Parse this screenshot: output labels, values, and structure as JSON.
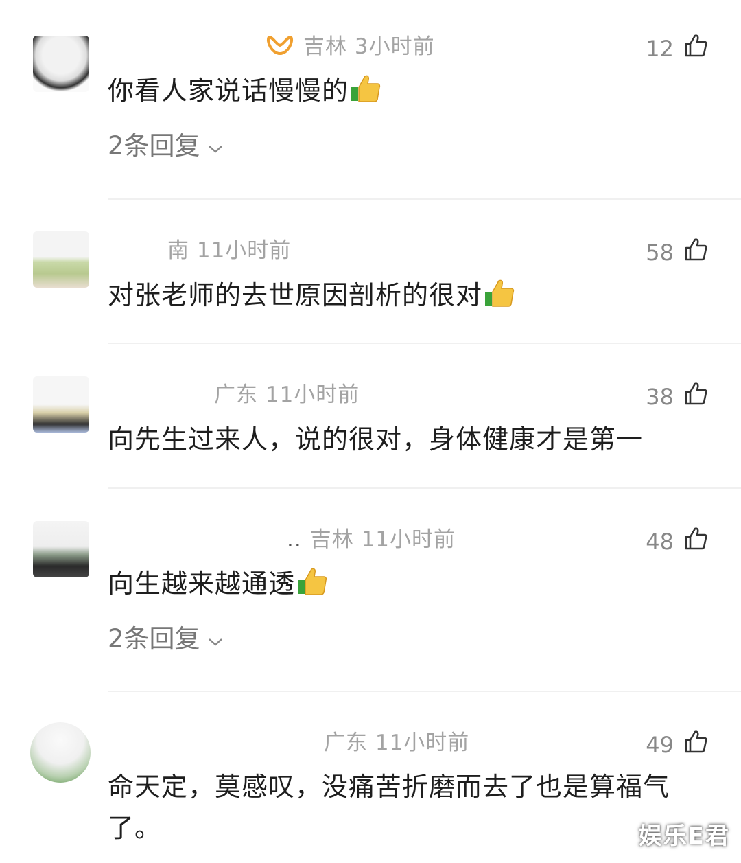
{
  "comments": [
    {
      "meta_prefix": "",
      "meta": "吉林 3小时前",
      "likes": "12",
      "text": "你看人家说话慢慢的",
      "replies": "2条回复"
    },
    {
      "meta_prefix": "",
      "meta": "南 11小时前",
      "likes": "58",
      "text": "对张老师的去世原因剖析的很对",
      "replies": ""
    },
    {
      "meta_prefix": "",
      "meta": "广东 11小时前",
      "likes": "38",
      "text": "向先生过来人，说的很对，身体健康才是第一",
      "replies": ""
    },
    {
      "meta_prefix": "..",
      "meta": "吉林 11小时前",
      "likes": "48",
      "text": "向生越来越通透",
      "replies": "2条回复"
    },
    {
      "meta_prefix": "",
      "meta": "广东 11小时前",
      "likes": "49",
      "text": "命天定，莫感叹，没痛苦折磨而去了也是算福气了。",
      "replies": ""
    }
  ],
  "watermark": "娱乐E君",
  "icons": {
    "like": "thumbs-up-outline-icon",
    "emoji": "thumbs-up-emoji-icon",
    "expand": "chevron-down-icon",
    "badge": "vip-badge-icon"
  },
  "colors": {
    "meta_text": "#a3a3a3",
    "body_text": "#1e1e1e",
    "badge": "#f0a030",
    "emoji_yellow": "#f5c542",
    "emoji_green": "#3aa33a"
  }
}
